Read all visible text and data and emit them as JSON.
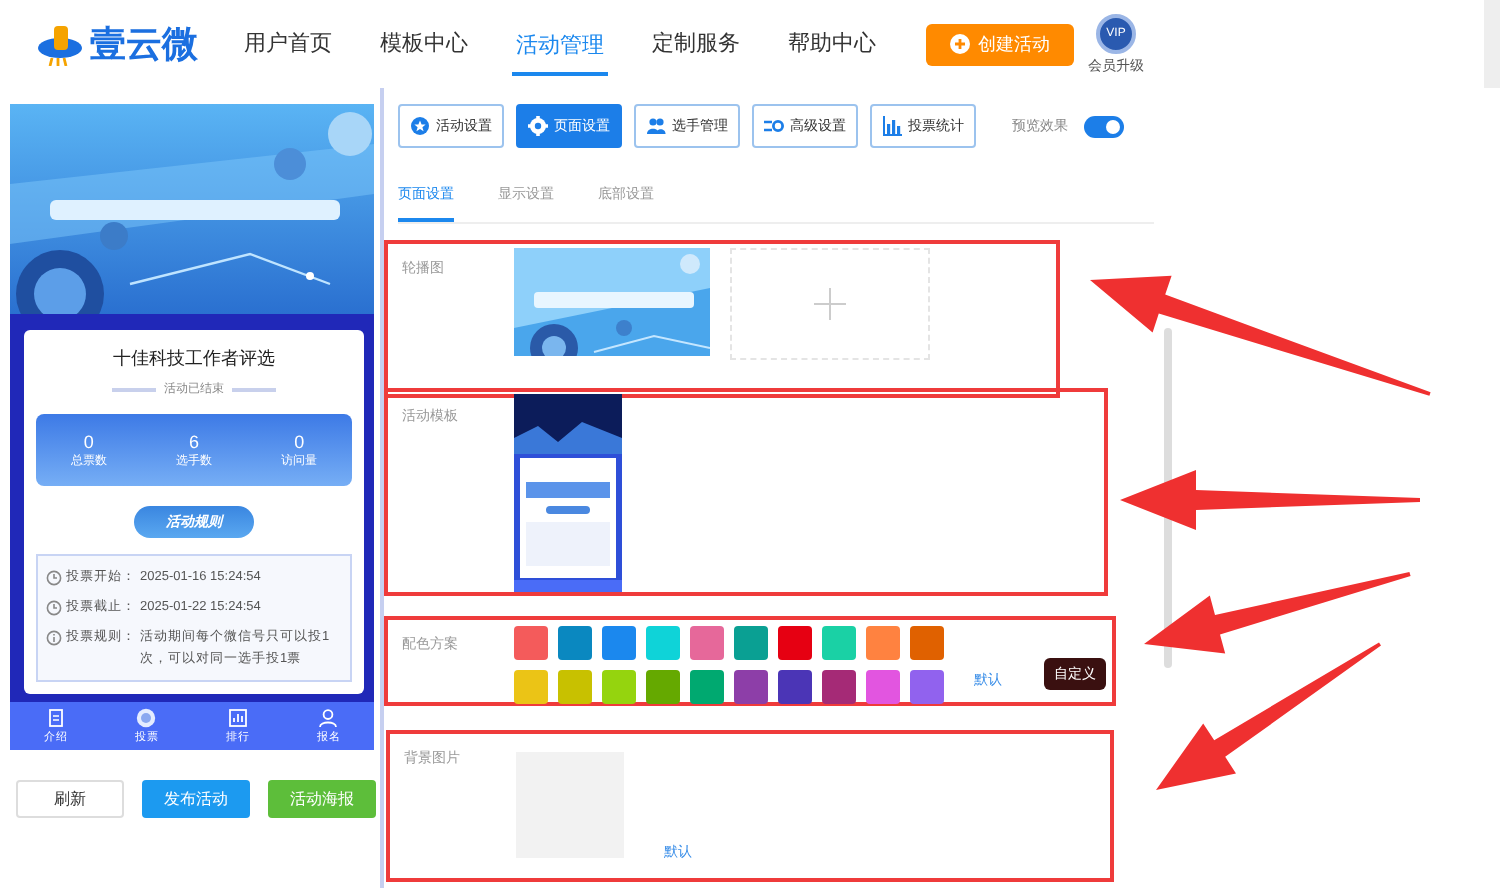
{
  "header": {
    "logo": "壹云微",
    "nav": [
      {
        "label": "用户首页",
        "selected": false
      },
      {
        "label": "模板中心",
        "selected": false
      },
      {
        "label": "活动管理",
        "selected": true
      },
      {
        "label": "定制服务",
        "selected": false
      },
      {
        "label": "帮助中心",
        "selected": false
      }
    ],
    "create_button": "创建活动",
    "vip_badge": "VIP",
    "vip_label": "会员升级"
  },
  "preview": {
    "title": "十佳科技工作者评选",
    "status": "活动已结束",
    "stats": [
      {
        "value": "0",
        "label": "总票数"
      },
      {
        "value": "6",
        "label": "选手数"
      },
      {
        "value": "0",
        "label": "访问量"
      }
    ],
    "rules_button": "活动规则",
    "rules": [
      {
        "label": "投票开始：",
        "value": "2025-01-16 15:24:54"
      },
      {
        "label": "投票截止：",
        "value": "2025-01-22 15:24:54"
      },
      {
        "label": "投票规则：",
        "value": "活动期间每个微信号只可以投1次，可以对同一选手投1票"
      }
    ],
    "bottom_nav": [
      {
        "label": "介绍",
        "selected": false
      },
      {
        "label": "投票",
        "selected": true
      },
      {
        "label": "排行",
        "selected": false
      },
      {
        "label": "报名",
        "selected": false
      }
    ]
  },
  "actions": [
    {
      "label": "刷新",
      "kind": "plain"
    },
    {
      "label": "发布活动",
      "kind": "blue"
    },
    {
      "label": "活动海报",
      "kind": "green"
    }
  ],
  "toolbar": [
    {
      "label": "活动设置",
      "selected": false
    },
    {
      "label": "页面设置",
      "selected": true
    },
    {
      "label": "选手管理",
      "selected": false
    },
    {
      "label": "高级设置",
      "selected": false
    },
    {
      "label": "投票统计",
      "selected": false
    }
  ],
  "preview_toggle": {
    "label": "预览效果",
    "on": true
  },
  "subtabs": [
    {
      "label": "页面设置",
      "selected": true
    },
    {
      "label": "显示设置",
      "selected": false
    },
    {
      "label": "底部设置",
      "selected": false
    }
  ],
  "sections": [
    {
      "kind": "carousel",
      "label": "轮播图",
      "highlighted": true
    },
    {
      "kind": "template",
      "label": "活动模板",
      "highlighted": true
    },
    {
      "kind": "colors",
      "label": "配色方案",
      "highlighted": true,
      "default_link": "默认",
      "custom_button": "自定义",
      "swatches": [
        {
          "color": "#f45b5b"
        },
        {
          "color": "#0a88c0"
        },
        {
          "color": "#1b88ee"
        },
        {
          "color": "#0fd3d8"
        },
        {
          "color": "#e6689a"
        },
        {
          "color": "#0aa093"
        },
        {
          "color": "#e60012"
        },
        {
          "color": "#1ad1a5"
        },
        {
          "color": "#ff8240"
        },
        {
          "color": "#e06100"
        },
        {
          "color": "#ebc416"
        },
        {
          "color": "#c8c100"
        },
        {
          "color": "#95d40e"
        },
        {
          "color": "#65a900"
        },
        {
          "color": "#00a970"
        },
        {
          "color": "#8d3ea8"
        },
        {
          "color": "#4b35b6"
        },
        {
          "color": "#a52a76"
        },
        {
          "color": "#e255e0"
        },
        {
          "color": "#9162ee"
        }
      ]
    },
    {
      "kind": "background",
      "label": "背景图片",
      "highlighted": true,
      "default_link": "默认"
    }
  ]
}
